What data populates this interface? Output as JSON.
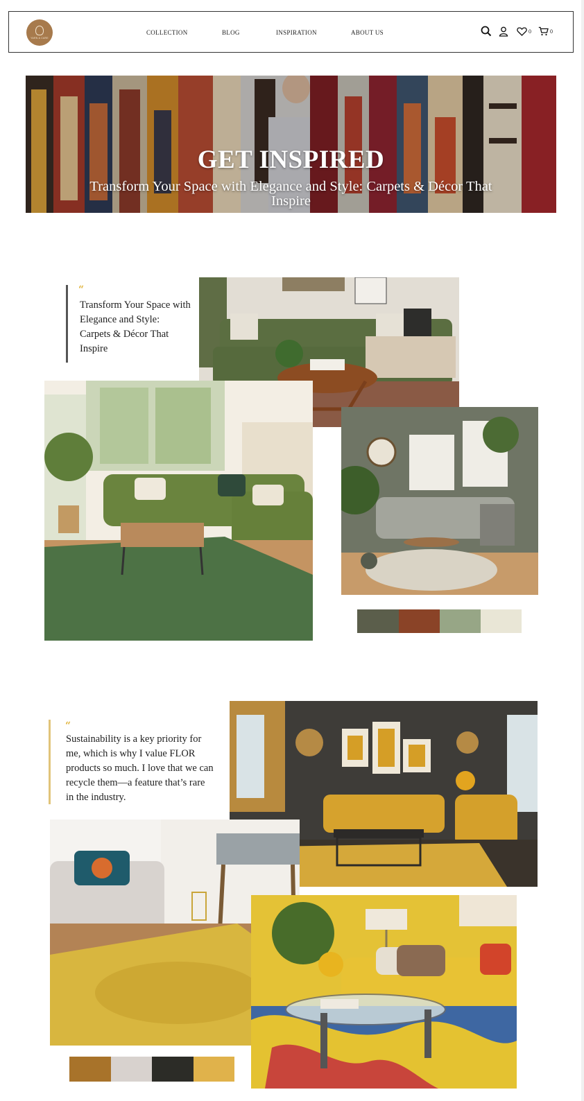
{
  "header": {
    "logo_text": "YARN & CARE",
    "nav": [
      {
        "label": "COLLECTION"
      },
      {
        "label": "BLOG"
      },
      {
        "label": "INSPIRATION"
      },
      {
        "label": "ABOUT US"
      }
    ],
    "wishlist_count": "0",
    "cart_count": "0",
    "icons": [
      "search-icon",
      "user-icon",
      "heart-icon",
      "cart-icon"
    ]
  },
  "hero": {
    "title": "GET INSPIRED",
    "subtitle": "Transform Your Space with Elegance and Style: Carpets & Décor That Inspire"
  },
  "section_green": {
    "quote": "Transform Your Space with Elegance and Style:  Carpets & Décor That Inspire",
    "palette": [
      "#5b5e4b",
      "#8a4327",
      "#97a686",
      "#e9e6d6"
    ]
  },
  "section_yellow": {
    "quote": "Sustainability is a key priority for me, which is why I value FLOR products so much. I love that we can recycle them—a feature that’s rare in the industry.",
    "palette": [
      "#a8732a",
      "#d8d2ce",
      "#2c2c27",
      "#e0b24b"
    ]
  },
  "colors": {
    "quote_mark": "#e1b53e",
    "logo": "#a77a4c",
    "quote_bar_green": "#555555",
    "quote_bar_yellow": "#e1c47a"
  }
}
